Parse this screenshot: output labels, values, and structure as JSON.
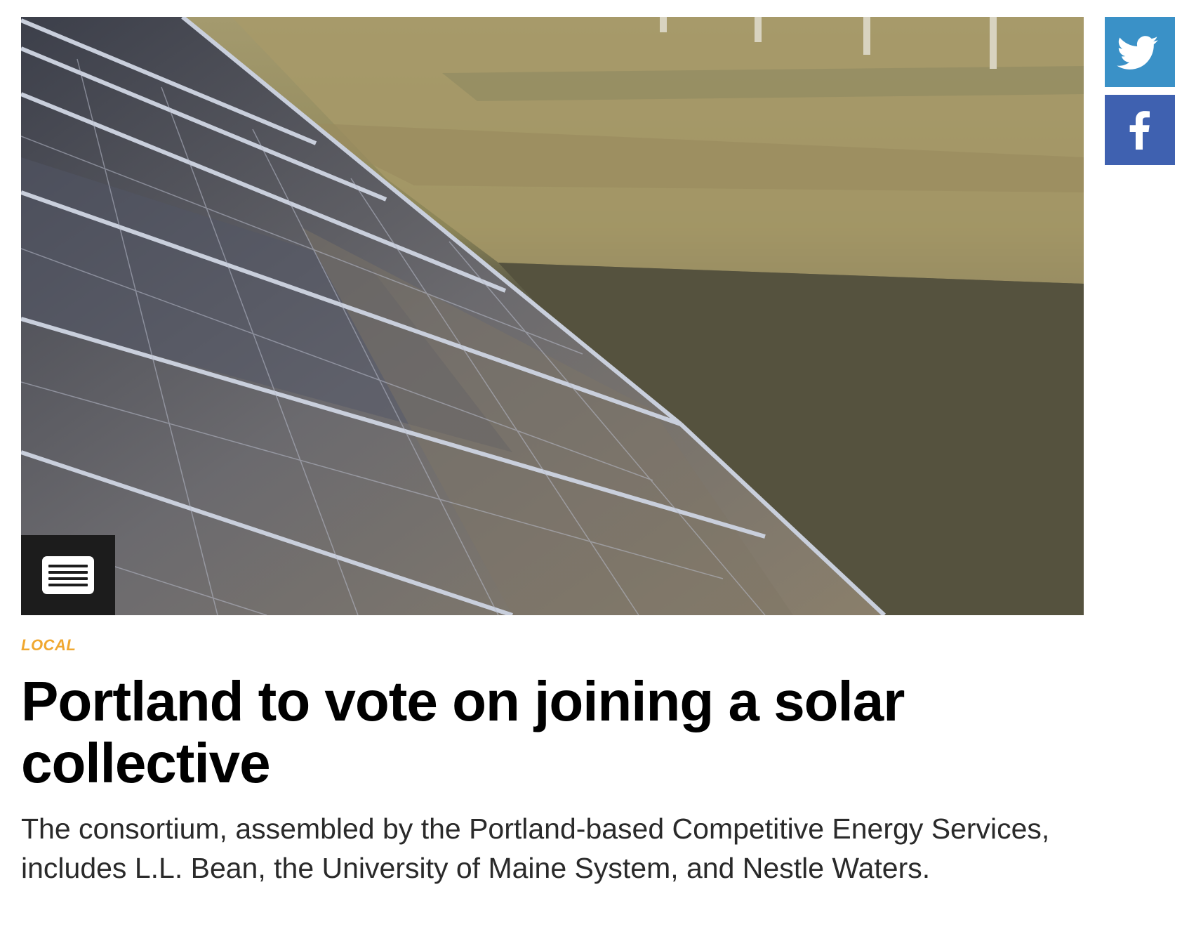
{
  "hero": {
    "image": "solar-panels-photo",
    "menu_icon": "hamburger-menu-icon"
  },
  "social": {
    "twitter_icon": "twitter-bird-icon",
    "facebook_icon": "facebook-f-icon",
    "twitter_color": "#3a91c7",
    "facebook_color": "#3f61b0"
  },
  "article": {
    "category": "LOCAL",
    "headline": "Portland to vote on joining a solar collective",
    "dek": "The consortium, assembled by the Portland-based Competitive Energy Services, includes L.L. Bean, the University of Maine System, and Nestle Waters."
  },
  "colors": {
    "category_accent": "#f0a830",
    "headline": "#000000",
    "dek": "#2a2a2a"
  }
}
